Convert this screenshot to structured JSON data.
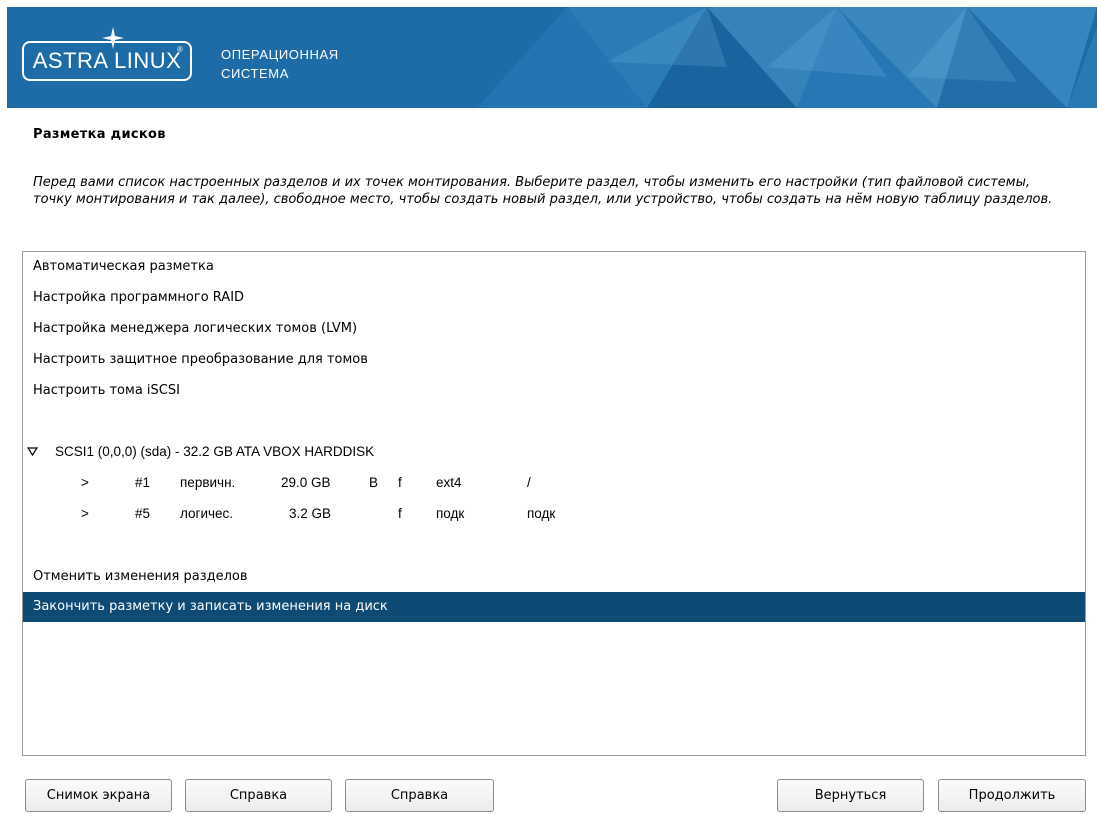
{
  "header": {
    "logo_text": "ASTRA LINUX",
    "logo_mark": "®",
    "os_line1": "ОПЕРАЦИОННАЯ",
    "os_line2": "СИСТЕМА"
  },
  "page": {
    "title": "Разметка дисков",
    "description": "Перед вами список настроенных разделов и их точек монтирования. Выберите раздел, чтобы изменить его настройки (тип файловой системы, точку монтирования и так далее), свободное место, чтобы создать новый раздел, или устройство, чтобы создать на нём новую таблицу разделов."
  },
  "list": {
    "auto": "Автоматическая разметка",
    "raid": "Настройка программного RAID",
    "lvm": "Настройка менеджера логических томов (LVM)",
    "crypto": "Настроить защитное преобразование для томов",
    "iscsi": "Настроить тома iSCSI",
    "disk": "SCSI1 (0,0,0) (sda) - 32.2 GB ATA VBOX HARDDISK",
    "partitions": [
      {
        "arrow": ">",
        "num": "#1",
        "type": "первичн.",
        "size": "29.0 GB",
        "boot": "B",
        "fmt": "f",
        "fs": "ext4",
        "mount": "/"
      },
      {
        "arrow": ">",
        "num": "#5",
        "type": "логичес.",
        "size": "3.2 GB",
        "boot": "",
        "fmt": "f",
        "fs": "подк",
        "mount": "подк"
      }
    ],
    "undo": "Отменить изменения разделов",
    "finish": "Закончить разметку и записать изменения на диск"
  },
  "buttons": {
    "screenshot": "Снимок экрана",
    "help1": "Справка",
    "help2": "Справка",
    "back": "Вернуться",
    "continue": "Продолжить"
  },
  "colors": {
    "banner": "#1d6ca8",
    "selection": "#0e4a74"
  }
}
